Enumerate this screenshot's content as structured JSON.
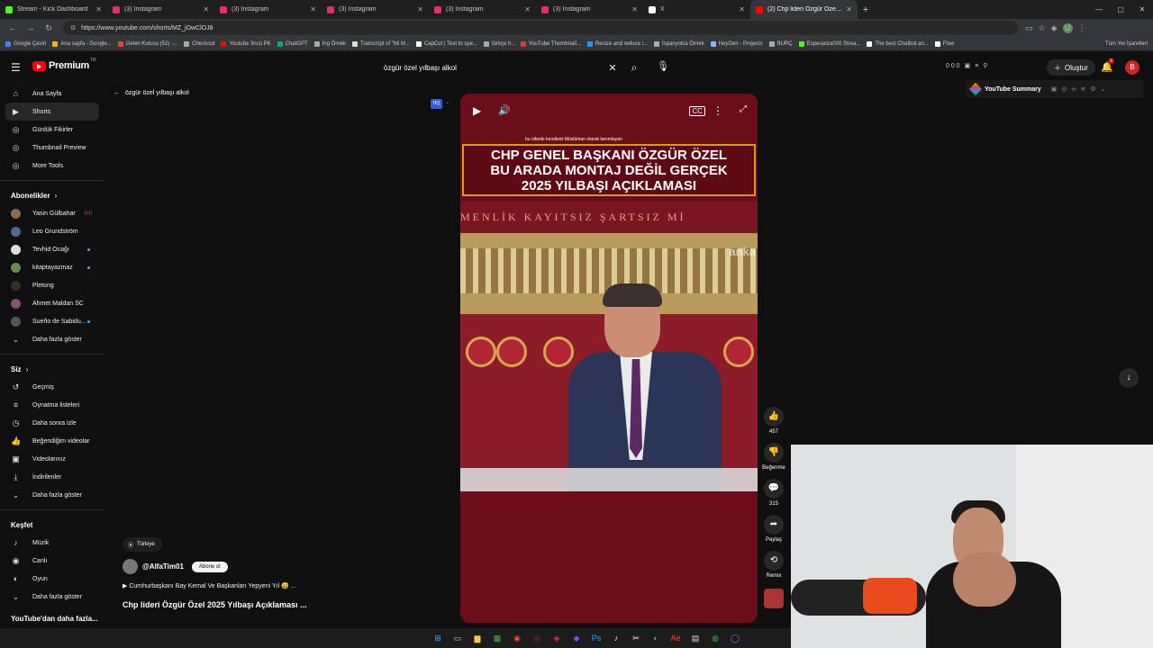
{
  "browser": {
    "tabs": [
      {
        "label": "Stream - Kick Dashboard",
        "color": "#53fc18",
        "active": false
      },
      {
        "label": "(3) Instagram",
        "color": "#e1306c",
        "active": false
      },
      {
        "label": "(3) Instagram",
        "color": "#e1306c",
        "active": false
      },
      {
        "label": "(3) Instagram",
        "color": "#e1306c",
        "active": false
      },
      {
        "label": "(3) Instagram",
        "color": "#e1306c",
        "active": false
      },
      {
        "label": "(3) Instagram",
        "color": "#e1306c",
        "active": false
      },
      {
        "label": "X",
        "color": "#ffffff",
        "active": false
      },
      {
        "label": "(2) Chp lideri Özgür Özel 2025",
        "color": "#ff0000",
        "active": true
      }
    ],
    "url": "https://www.youtube.com/shorts/MZ_jOwClOJ8",
    "bookmarks": [
      "Google Çeviri",
      "Ana sayfa - Google...",
      "Gelen Kutusu (52) -...",
      "Checkout",
      "Youtube 3ncü PK",
      "ChatGPT",
      "İng Örnek",
      "Transcript of \"Mi M...",
      "CapCut | Text to spe...",
      "türkçe h..",
      "YouTube Thumbnail...",
      "Resize and reduce i...",
      "İspanyolca Örnek",
      "HeyGen - Projects",
      "BURÇ",
      "Esperanza000 Strea...",
      "The best Chatbot an...",
      "Flow"
    ],
    "bookmarks_right": "Tüm Yer İşaretleri"
  },
  "header": {
    "brand": "Premium",
    "brand_sup": "TR",
    "search_query": "özgür özel yılbaşı alkol",
    "stats": "0  0  0",
    "create_label": "Oluştur",
    "notif_count": "9",
    "avatar_letter": "B"
  },
  "sidebar": {
    "main": [
      {
        "label": "Ana Sayfa",
        "icon": "⌂"
      },
      {
        "label": "Shorts",
        "icon": "▶"
      },
      {
        "label": "Günlük Fikirler",
        "icon": "◎"
      },
      {
        "label": "Thumbnail Preview",
        "icon": "◎"
      },
      {
        "label": "More Tools",
        "icon": "◎"
      }
    ],
    "subs_title": "Abonelikler",
    "subs": [
      {
        "label": "Yasin Gülbahar",
        "color": "#8a6b4f"
      },
      {
        "label": "Leo Grundström",
        "color": "#4f6a8a"
      },
      {
        "label": "Tevhid Ocağı",
        "color": "#dddddd"
      },
      {
        "label": "kitaptayazmaz",
        "color": "#6b8a4f"
      },
      {
        "label": "Pletong",
        "color": "#3a2a2a"
      },
      {
        "label": "Ahmet Maldan SC",
        "color": "#8a4f7a"
      },
      {
        "label": "Sueño de Sabidu...",
        "color": "#555555"
      }
    ],
    "subs_more": "Daha fazla göster",
    "you_title": "Siz",
    "you": [
      {
        "label": "Geçmiş",
        "icon": "↺"
      },
      {
        "label": "Oynatma listeleri",
        "icon": "≡"
      },
      {
        "label": "Daha sonra izle",
        "icon": "◷"
      },
      {
        "label": "Beğendiğim videolar",
        "icon": "👍"
      },
      {
        "label": "Videolarınız",
        "icon": "▣"
      },
      {
        "label": "İndirilenler",
        "icon": "⤓"
      }
    ],
    "you_more": "Daha fazla göster",
    "explore_title": "Keşfet",
    "explore": [
      {
        "label": "Müzik",
        "icon": "♪"
      },
      {
        "label": "Canlı",
        "icon": "◉"
      },
      {
        "label": "Oyun",
        "icon": "◐"
      }
    ],
    "explore_more": "Daha fazla göster",
    "footer": "YouTube'dan daha fazla..."
  },
  "back_title": "özgür özel yılbaşı alkol",
  "video": {
    "small_caption": "bu ülkede kendisini Müslüman olarak tanımlayan",
    "headline_lines": [
      "CHP GENEL BAŞKANI ÖZGÜR ÖZEL",
      "BU ARADA MONTAJ DEĞİL GERÇEK",
      "2025 YILBAŞI AÇIKLAMASI"
    ],
    "banner_text": "MENLİK KAYITSIZ ŞARTSIZ Mİ",
    "watermark": "anka",
    "hq": "HQ"
  },
  "rail": {
    "likes": "457",
    "dislike_label": "Beğenme",
    "comments": "315",
    "share_label": "Paylaş",
    "remix_label": "Remix"
  },
  "channel": {
    "location": "Türkiye",
    "name": "@AlfaTim01",
    "subscribe_label": "Abone ol",
    "music": "▶ Cumhurbaşkanı Bay Kemal Ve Başkanları Yepyeni Yıl 😅 ...",
    "title": "Chp lideri Özgür Özel 2025 Yılbaşı Açıklaması ..."
  },
  "extension": {
    "title": "YouTube Summary"
  }
}
